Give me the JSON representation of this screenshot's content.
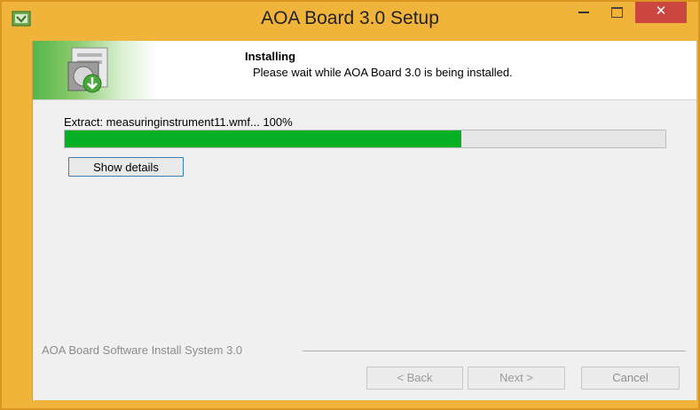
{
  "window": {
    "title": "AOA Board 3.0 Setup",
    "close_glyph": "✕"
  },
  "header": {
    "title": "Installing",
    "subtitle": "Please wait while AOA Board 3.0 is being installed."
  },
  "progress": {
    "status_text": "Extract: measuringinstrument11.wmf... 100%",
    "fill_fraction": 0.66
  },
  "buttons": {
    "show_details": "Show details",
    "back": "< Back",
    "next": "Next >",
    "cancel": "Cancel"
  },
  "footer": {
    "brand": "AOA Board Software Install System 3.0"
  },
  "colors": {
    "frame": "#f0b43a",
    "progress_fill": "#06b025",
    "close_button": "#c9473f"
  },
  "icons": {
    "app": "installer-app-icon",
    "header": "install-download-icon"
  }
}
